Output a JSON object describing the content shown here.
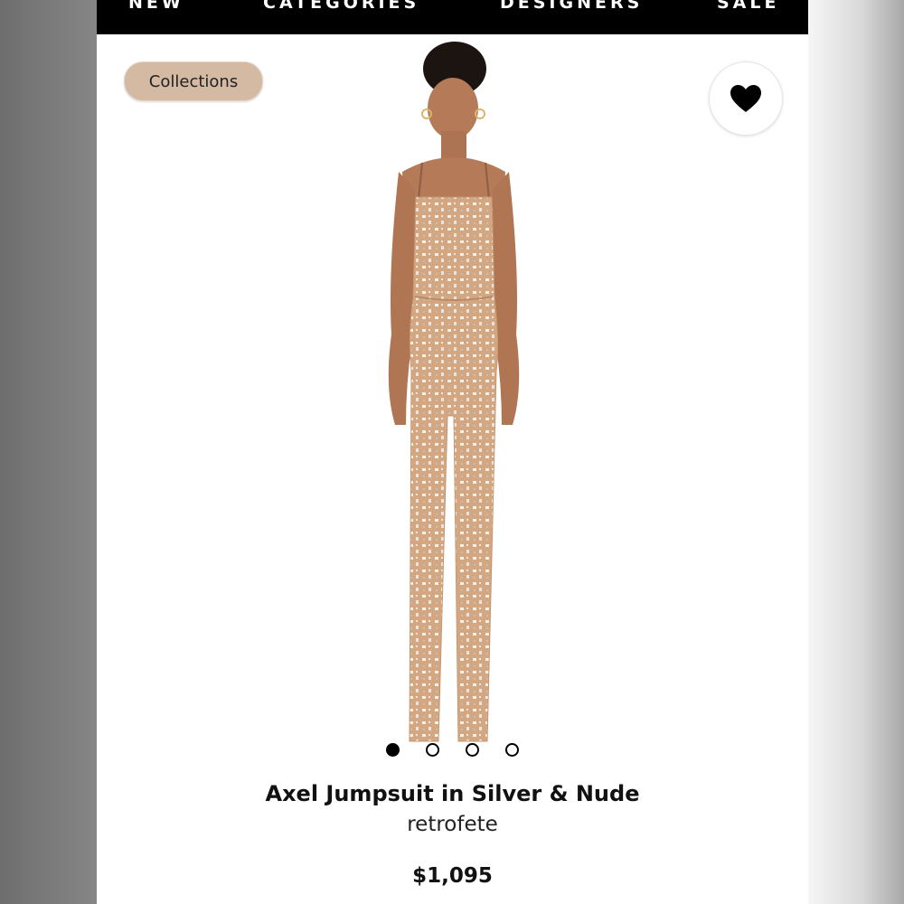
{
  "nav": {
    "items": [
      "NEW",
      "CATEGORIES",
      "DESIGNERS",
      "SALE"
    ]
  },
  "collections_label": "Collections",
  "favorite": {
    "icon": "heart-icon",
    "selected": true
  },
  "product": {
    "title": "Axel Jumpsuit in Silver & Nude",
    "brand": "retrofete",
    "price": "$1,095",
    "image": {
      "subject": "model wearing embellished nude sheer jumpsuit"
    }
  },
  "carousel": {
    "count": 4,
    "active_index": 0
  },
  "colors": {
    "nav_bg": "#000000",
    "pill_bg": "#d4baa3",
    "garment": "#d2a37f",
    "skin": "#b47c5a"
  }
}
